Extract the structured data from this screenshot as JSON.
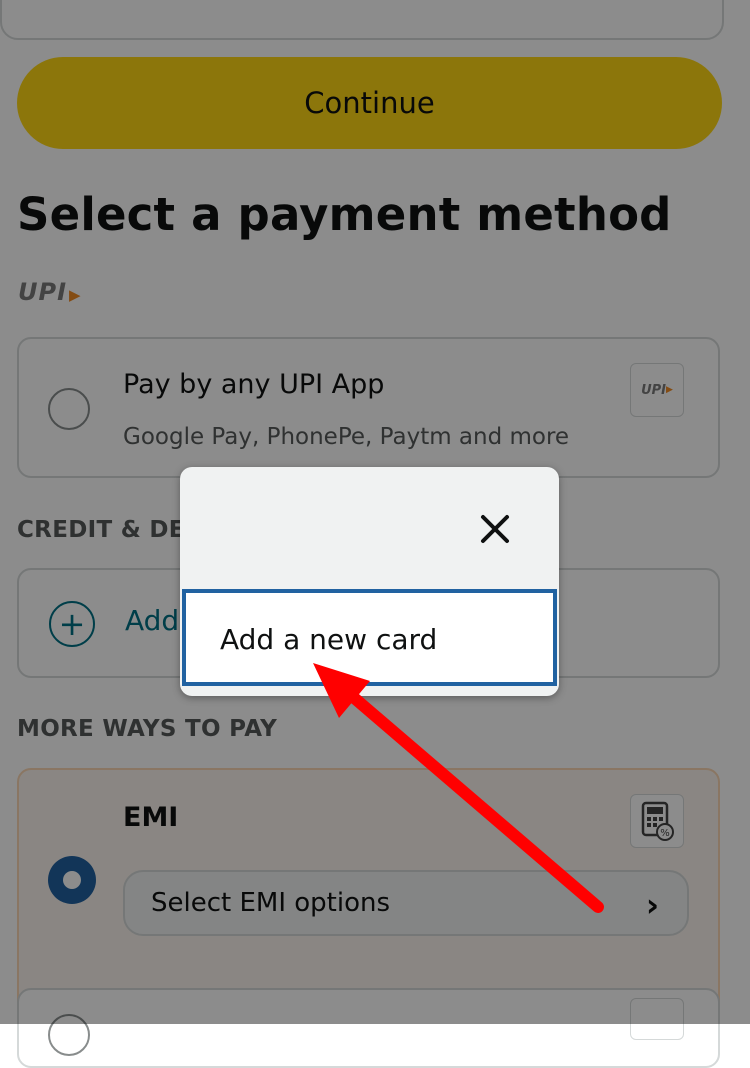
{
  "continue_label": "Continue",
  "page_title": "Select a payment method",
  "upi_section": {
    "logo_text": "UPI",
    "option": {
      "title": "Pay by any UPI App",
      "subtitle": "Google Pay, PhonePe, Paytm and more",
      "badge_text": "UPI",
      "selected": false
    }
  },
  "credit_section": {
    "heading": "CREDIT & DE",
    "add_card_label": "Add"
  },
  "more_ways": {
    "heading": "MORE WAYS TO PAY",
    "emi": {
      "title": "EMI",
      "selected": true,
      "select_label": "Select EMI options",
      "icon": "calculator-percent-icon"
    }
  },
  "popover": {
    "close_icon": "close-icon",
    "option_label": "Add a new card"
  },
  "colors": {
    "button_yellow": "#ffd814",
    "link_teal": "#007185",
    "selected_blue": "#2162a1",
    "emi_background": "#fcf5ee",
    "annotation_arrow": "#ff0000"
  }
}
